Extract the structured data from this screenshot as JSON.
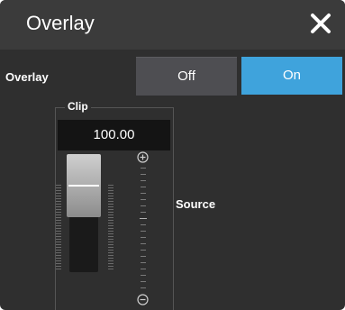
{
  "dialog": {
    "title": "Overlay",
    "close_icon": "close-icon"
  },
  "overlay_row": {
    "label": "Overlay",
    "options": [
      {
        "label": "Off",
        "selected": false
      },
      {
        "label": "On",
        "selected": true
      }
    ],
    "selected_color": "#3fa3dc",
    "unselected_color": "#4e4e52"
  },
  "clip": {
    "label": "Clip",
    "value": "100.00",
    "level_fraction": 1.0,
    "increase_icon": "plus-circle-icon",
    "decrease_icon": "minus-circle-icon"
  },
  "source": {
    "label": "Source"
  }
}
